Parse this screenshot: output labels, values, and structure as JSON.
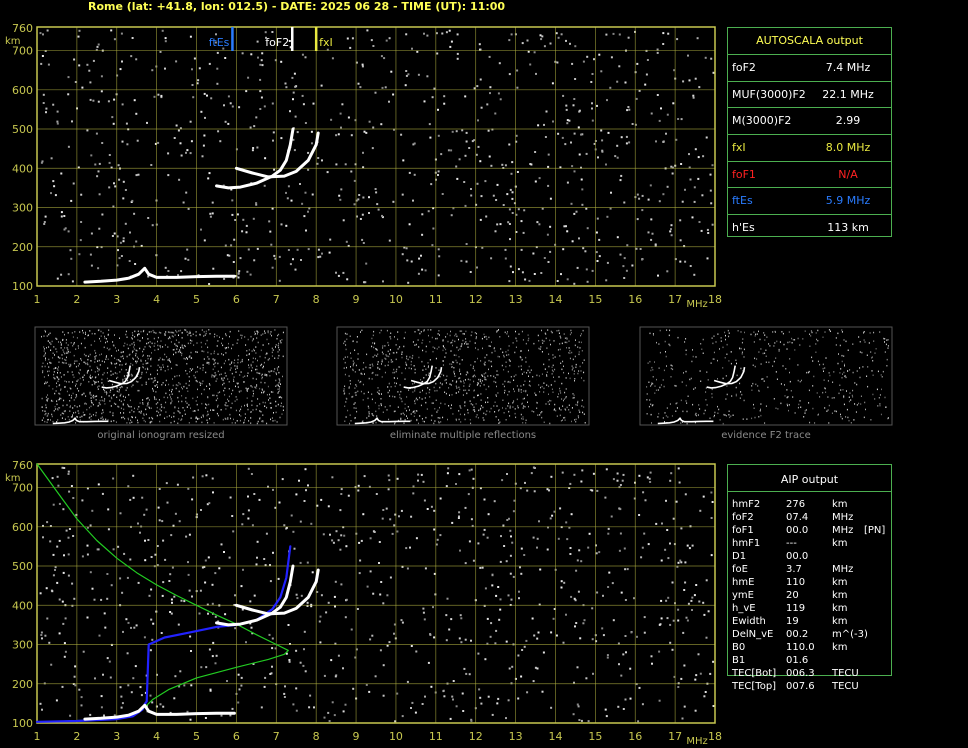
{
  "header": {
    "title": "Rome (lat: +41.8, lon: 012.5) - DATE: 2025 06 28 - TIME (UT): 11:00"
  },
  "axes": {
    "y_unit": "km",
    "x_unit": "MHz",
    "y_ticks": [
      "760",
      "700",
      "600",
      "500",
      "400",
      "300",
      "200",
      "100"
    ],
    "x_ticks": [
      "1",
      "2",
      "3",
      "4",
      "5",
      "6",
      "7",
      "8",
      "9",
      "10",
      "11",
      "12",
      "13",
      "14",
      "15",
      "16",
      "17",
      "18"
    ]
  },
  "colors": {
    "grid": "#b0b040",
    "frame": "#c8c850",
    "noise": "#9a9a9a",
    "trace": "#ffffff",
    "ftEs": "#2a7cff",
    "foF2": "#ffffff",
    "fxI": "#e8e840",
    "profile_green": "#22cc22",
    "profile_blue": "#2222ff",
    "panel_border": "#4caf50"
  },
  "markers": [
    {
      "label": "ftEs",
      "x": 5.9,
      "color": "#2a7cff"
    },
    {
      "label": "foF2",
      "x": 7.4,
      "color": "#ffffff"
    },
    {
      "label": "fxI",
      "x": 8.0,
      "color": "#e8e840"
    }
  ],
  "autoscala": {
    "title": "AUTOSCALA output",
    "rows": [
      {
        "label": "foF2",
        "value": "7.4  MHz",
        "color": "#ffffff"
      },
      {
        "label": "MUF(3000)F2",
        "value": "22.1  MHz",
        "color": "#ffffff"
      },
      {
        "label": "M(3000)F2",
        "value": "2.99",
        "color": "#ffffff"
      },
      {
        "label": "fxI",
        "value": "8.0  MHz",
        "color": "#e8e840"
      },
      {
        "label": "foF1",
        "value": "N/A",
        "color": "#ff2222"
      },
      {
        "label": "ftEs",
        "value": "5.9  MHz",
        "color": "#2a7cff"
      },
      {
        "label": "h'Es",
        "value": "113    km",
        "color": "#ffffff"
      }
    ]
  },
  "aip": {
    "title": "AIP output",
    "rows": [
      {
        "name": "hmF2",
        "value": "276",
        "unit": "km",
        "extra": ""
      },
      {
        "name": "foF2",
        "value": "07.4",
        "unit": "MHz",
        "extra": ""
      },
      {
        "name": "foF1",
        "value": "00.0",
        "unit": "MHz",
        "extra": "[PN]"
      },
      {
        "name": "hmF1",
        "value": "---",
        "unit": "km",
        "extra": ""
      },
      {
        "name": "D1",
        "value": "00.0",
        "unit": "",
        "extra": ""
      },
      {
        "name": "foE",
        "value": "3.7",
        "unit": "MHz",
        "extra": ""
      },
      {
        "name": "hmE",
        "value": "110",
        "unit": "km",
        "extra": ""
      },
      {
        "name": "ymE",
        "value": "20",
        "unit": "km",
        "extra": ""
      },
      {
        "name": "h_vE",
        "value": "119",
        "unit": "km",
        "extra": ""
      },
      {
        "name": "Ewidth",
        "value": "19",
        "unit": "km",
        "extra": ""
      },
      {
        "name": "DelN_vE",
        "value": "00.2",
        "unit": "m^(-3)",
        "extra": ""
      },
      {
        "name": "B0",
        "value": "110.0",
        "unit": "km",
        "extra": ""
      },
      {
        "name": "B1",
        "value": "01.6",
        "unit": "",
        "extra": ""
      },
      {
        "name": "TEC[Bot]",
        "value": "006.3",
        "unit": "TECU",
        "extra": ""
      },
      {
        "name": "TEC[Top]",
        "value": "007.6",
        "unit": "TECU",
        "extra": ""
      }
    ]
  },
  "thumbnails": [
    {
      "caption": "original ionogram resized"
    },
    {
      "caption": "eliminate multiple reflections"
    },
    {
      "caption": "evidence F2 trace"
    }
  ],
  "chart_data": [
    {
      "type": "scatter",
      "name": "ionogram_top",
      "xlim": [
        1,
        18
      ],
      "ylim": [
        100,
        760
      ],
      "series": [
        {
          "name": "E trace",
          "points": [
            [
              2.2,
              110
            ],
            [
              2.6,
              112
            ],
            [
              3.0,
              115
            ],
            [
              3.3,
              120
            ],
            [
              3.55,
              130
            ],
            [
              3.7,
              145
            ],
            [
              3.8,
              130
            ],
            [
              4.0,
              122
            ],
            [
              4.5,
              122
            ],
            [
              5.0,
              124
            ],
            [
              5.5,
              125
            ],
            [
              5.95,
              125
            ]
          ]
        },
        {
          "name": "F trace o",
          "points": [
            [
              5.5,
              355
            ],
            [
              5.8,
              350
            ],
            [
              6.1,
              352
            ],
            [
              6.5,
              362
            ],
            [
              6.9,
              380
            ],
            [
              7.1,
              395
            ],
            [
              7.25,
              420
            ],
            [
              7.35,
              460
            ],
            [
              7.42,
              500
            ]
          ]
        },
        {
          "name": "F trace x",
          "points": [
            [
              6.0,
              400
            ],
            [
              6.4,
              388
            ],
            [
              6.8,
              378
            ],
            [
              7.2,
              380
            ],
            [
              7.5,
              392
            ],
            [
              7.8,
              420
            ],
            [
              8.0,
              460
            ],
            [
              8.05,
              490
            ]
          ]
        }
      ]
    },
    {
      "type": "line",
      "name": "profile_bottom",
      "xlim": [
        1,
        18
      ],
      "ylim": [
        100,
        760
      ],
      "series": [
        {
          "name": "green profile",
          "points": [
            [
              1.0,
              760
            ],
            [
              1.5,
              690
            ],
            [
              2.0,
              620
            ],
            [
              2.5,
              565
            ],
            [
              3.0,
              520
            ],
            [
              3.5,
              483
            ],
            [
              4.0,
              452
            ],
            [
              4.5,
              425
            ],
            [
              5.0,
              400
            ],
            [
              5.5,
              375
            ],
            [
              6.0,
              352
            ],
            [
              6.5,
              325
            ],
            [
              7.0,
              300
            ],
            [
              7.3,
              285
            ],
            [
              7.2,
              275
            ],
            [
              6.8,
              262
            ],
            [
              6.0,
              242
            ],
            [
              5.0,
              215
            ],
            [
              4.3,
              185
            ],
            [
              3.9,
              160
            ],
            [
              3.7,
              140
            ],
            [
              3.3,
              118
            ],
            [
              2.5,
              108
            ],
            [
              1.5,
              104
            ],
            [
              1.0,
              103
            ]
          ]
        },
        {
          "name": "blue profile",
          "points": [
            [
              1.0,
              103
            ],
            [
              2.0,
              105
            ],
            [
              3.0,
              110
            ],
            [
              3.4,
              117
            ],
            [
              3.65,
              135
            ],
            [
              3.7,
              148
            ],
            [
              3.75,
              155
            ],
            [
              3.8,
              300
            ],
            [
              4.2,
              318
            ],
            [
              4.8,
              330
            ],
            [
              5.5,
              345
            ],
            [
              6.0,
              350
            ],
            [
              6.5,
              362
            ],
            [
              6.9,
              390
            ],
            [
              7.1,
              420
            ],
            [
              7.25,
              470
            ],
            [
              7.35,
              550
            ]
          ]
        },
        {
          "name": "E trace",
          "points": [
            [
              2.2,
              110
            ],
            [
              2.6,
              112
            ],
            [
              3.0,
              115
            ],
            [
              3.3,
              120
            ],
            [
              3.55,
              130
            ],
            [
              3.7,
              145
            ],
            [
              3.8,
              130
            ],
            [
              4.0,
              122
            ],
            [
              4.5,
              122
            ],
            [
              5.0,
              124
            ],
            [
              5.5,
              125
            ],
            [
              5.95,
              125
            ]
          ]
        },
        {
          "name": "F trace o",
          "points": [
            [
              5.5,
              355
            ],
            [
              5.8,
              350
            ],
            [
              6.1,
              352
            ],
            [
              6.5,
              362
            ],
            [
              6.9,
              380
            ],
            [
              7.1,
              395
            ],
            [
              7.25,
              420
            ],
            [
              7.35,
              460
            ],
            [
              7.42,
              500
            ]
          ]
        },
        {
          "name": "F trace x",
          "points": [
            [
              6.0,
              400
            ],
            [
              6.4,
              388
            ],
            [
              6.8,
              378
            ],
            [
              7.2,
              380
            ],
            [
              7.5,
              392
            ],
            [
              7.8,
              420
            ],
            [
              8.0,
              460
            ],
            [
              8.05,
              490
            ]
          ]
        }
      ]
    }
  ]
}
